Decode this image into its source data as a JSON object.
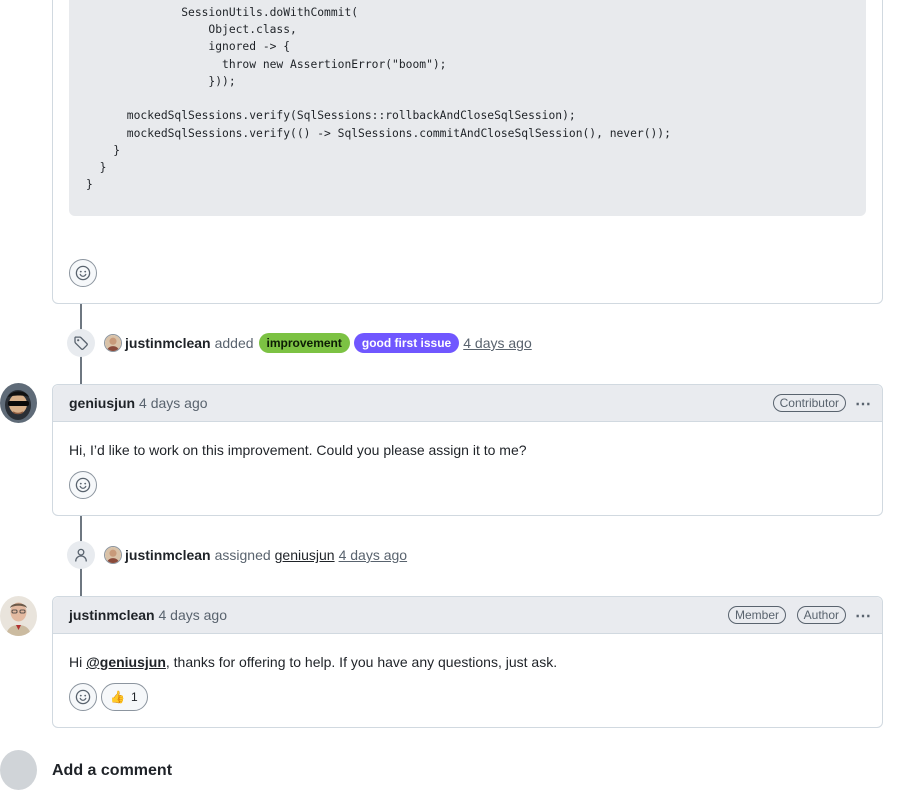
{
  "code": {
    "lines": [
      "          () ->",
      "              SessionUtils.doWithCommit(",
      "                  Object.class,",
      "                  ignored -> {",
      "                    throw new AssertionError(\"boom\");",
      "                  }));",
      "",
      "      mockedSqlSessions.verify(SqlSessions::rollbackAndCloseSqlSession);",
      "      mockedSqlSessions.verify(() -> SqlSessions.commitAndCloseSqlSession(), never());",
      "    }",
      "  }",
      "}"
    ]
  },
  "events": {
    "labeled": {
      "actor": "justinmclean",
      "verb": "added",
      "labels": [
        {
          "text": "improvement",
          "bg": "#7cc243",
          "fg": "#0d1d05"
        },
        {
          "text": "good first issue",
          "bg": "#7057ff",
          "fg": "#ffffff"
        }
      ],
      "time": "4 days ago"
    },
    "assigned": {
      "actor": "justinmclean",
      "verb": "assigned",
      "assignee": "geniusjun",
      "time": "4 days ago"
    }
  },
  "comments": [
    {
      "author": "geniusjun",
      "time": "4 days ago",
      "badges": [
        "Contributor"
      ],
      "body": "Hi, I’d like to work on this improvement. Could you please assign it to me?"
    },
    {
      "author": "justinmclean",
      "time": "4 days ago",
      "badges": [
        "Member",
        "Author"
      ],
      "body_prefix": "Hi ",
      "mention": "@geniusjun",
      "body_suffix": ", thanks for offering to help. If you have any questions, just ask.",
      "reaction": {
        "emoji": "👍",
        "count": "1"
      }
    }
  ],
  "footer": {
    "add_comment": "Add a comment"
  },
  "more_icon": "⋯"
}
